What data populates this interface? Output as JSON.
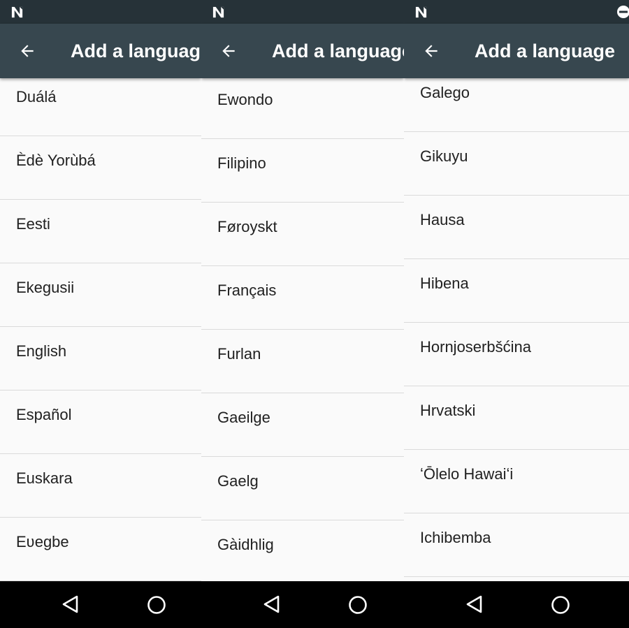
{
  "colors": {
    "status_bar": "#263238",
    "app_bar": "#37474f",
    "list_background": "#fafafa",
    "divider": "#dadada",
    "text_primary": "#212121",
    "nav_bar": "#000000"
  },
  "panels": [
    {
      "title": "Add a language",
      "items": [
        "Duálá",
        "Èdè Yorùbá",
        "Eesti",
        "Ekegusii",
        "English",
        "Español",
        "Euskara",
        "Eʋegbe"
      ]
    },
    {
      "title": "Add a language",
      "items": [
        "Ewondo",
        "Filipino",
        "Føroyskt",
        "Français",
        "Furlan",
        "Gaeilge",
        "Gaelg",
        "Gàidhlig"
      ]
    },
    {
      "title": "Add a language",
      "items": [
        "Galego",
        "Gikuyu",
        "Hausa",
        "Hibena",
        "Hornjoserbšćina",
        "Hrvatski",
        "ʻŌlelo Hawaiʻi",
        "Ichibemba"
      ]
    }
  ]
}
